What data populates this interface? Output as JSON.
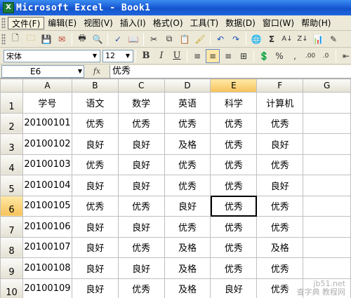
{
  "window": {
    "title": "Microsoft Excel - Book1"
  },
  "menu": [
    {
      "label": "文件(F)",
      "active": true
    },
    {
      "label": "编辑(E)"
    },
    {
      "label": "视图(V)"
    },
    {
      "label": "插入(I)"
    },
    {
      "label": "格式(O)"
    },
    {
      "label": "工具(T)"
    },
    {
      "label": "数据(D)"
    },
    {
      "label": "窗口(W)"
    },
    {
      "label": "帮助(H)"
    }
  ],
  "format_toolbar": {
    "font": "宋体",
    "size": "12",
    "zoom": "%"
  },
  "formula_bar": {
    "cell_ref": "E6",
    "fx": "fx",
    "content": "优秀"
  },
  "columns": [
    "A",
    "B",
    "C",
    "D",
    "E",
    "F",
    "G"
  ],
  "selected": {
    "col": "E",
    "row": 6
  },
  "rows": [
    {
      "n": 1,
      "cells": [
        "学号",
        "语文",
        "数学",
        "英语",
        "科学",
        "计算机",
        ""
      ]
    },
    {
      "n": 2,
      "cells": [
        "20100101",
        "优秀",
        "优秀",
        "优秀",
        "优秀",
        "优秀",
        ""
      ]
    },
    {
      "n": 3,
      "cells": [
        "20100102",
        "良好",
        "良好",
        "及格",
        "优秀",
        "良好",
        ""
      ]
    },
    {
      "n": 4,
      "cells": [
        "20100103",
        "优秀",
        "良好",
        "优秀",
        "优秀",
        "优秀",
        ""
      ]
    },
    {
      "n": 5,
      "cells": [
        "20100104",
        "良好",
        "良好",
        "优秀",
        "优秀",
        "良好",
        ""
      ]
    },
    {
      "n": 6,
      "cells": [
        "20100105",
        "优秀",
        "优秀",
        "良好",
        "优秀",
        "优秀",
        ""
      ]
    },
    {
      "n": 7,
      "cells": [
        "20100106",
        "良好",
        "良好",
        "优秀",
        "优秀",
        "优秀",
        ""
      ]
    },
    {
      "n": 8,
      "cells": [
        "20100107",
        "良好",
        "优秀",
        "及格",
        "优秀",
        "及格",
        ""
      ]
    },
    {
      "n": 9,
      "cells": [
        "20100108",
        "良好",
        "良好",
        "及格",
        "优秀",
        "优秀",
        ""
      ]
    },
    {
      "n": 10,
      "cells": [
        "20100109",
        "良好",
        "优秀",
        "及格",
        "良好",
        "优秀",
        ""
      ]
    }
  ],
  "watermark": {
    "line1": "jb51.net",
    "line2": "查字典 教程网"
  }
}
